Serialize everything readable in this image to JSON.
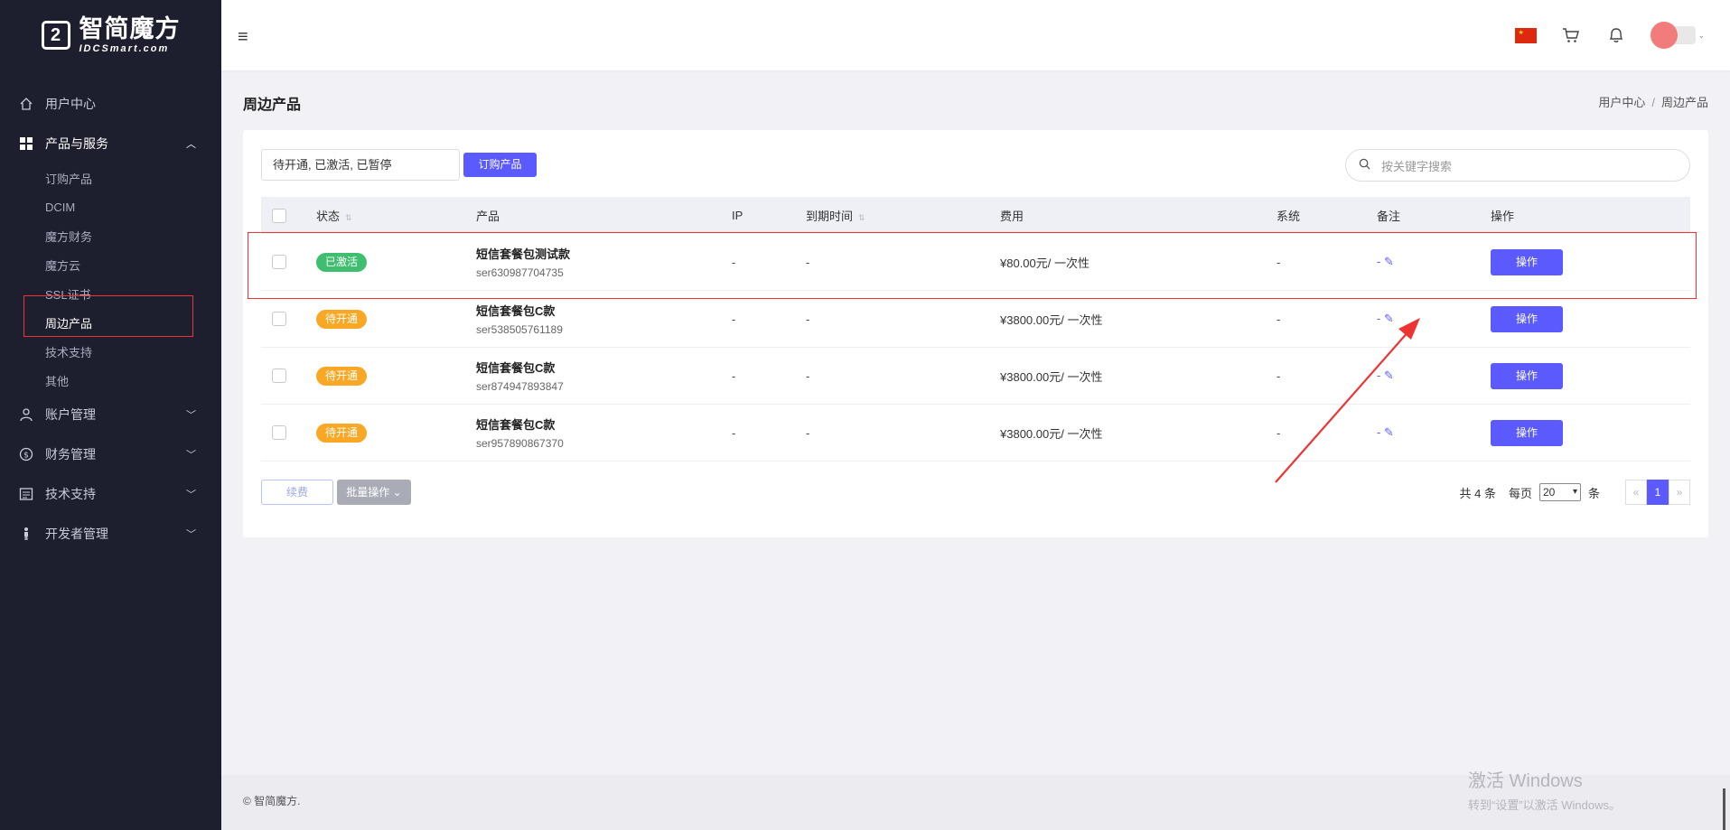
{
  "logo": {
    "cn": "智简魔方",
    "en": "IDCSmart.com"
  },
  "sidebar": {
    "items": [
      {
        "label": "用户中心",
        "icon": "home-icon"
      },
      {
        "label": "产品与服务",
        "icon": "grid-icon",
        "expanded": true,
        "children": [
          "订购产品",
          "DCIM",
          "魔方财务",
          "魔方云",
          "SSL证书",
          "周边产品",
          "技术支持",
          "其他"
        ],
        "current_child": "周边产品"
      },
      {
        "label": "账户管理",
        "icon": "user-icon"
      },
      {
        "label": "财务管理",
        "icon": "dollar-circle-icon"
      },
      {
        "label": "技术支持",
        "icon": "document-icon"
      },
      {
        "label": "开发者管理",
        "icon": "person-icon"
      }
    ]
  },
  "header": {
    "menu_icon": "hamburger-icon",
    "icons": [
      "china-flag-icon",
      "cart-icon",
      "bell-icon",
      "avatar"
    ]
  },
  "page": {
    "title": "周边产品",
    "breadcrumb": [
      "用户中心",
      "/",
      "周边产品"
    ]
  },
  "toolbar": {
    "filter_value": "待开通, 已激活, 已暂停",
    "order_button": "订购产品",
    "search_placeholder": "按关键字搜索"
  },
  "table": {
    "headers": {
      "status": "状态",
      "product": "产品",
      "ip": "IP",
      "expiry": "到期时间",
      "fee": "费用",
      "system": "系统",
      "note": "备注",
      "ops": "操作"
    },
    "rows": [
      {
        "status": "已激活",
        "status_color": "#3ebe6e",
        "name": "短信套餐包测试款",
        "id": "ser630987704735",
        "ip": "-",
        "expiry": "-",
        "fee": "¥80.00元/ 一次性",
        "system": "-",
        "note": "-",
        "op": "操作"
      },
      {
        "status": "待开通",
        "status_color": "#f8a824",
        "name": "短信套餐包C款",
        "id": "ser538505761189",
        "ip": "-",
        "expiry": "-",
        "fee": "¥3800.00元/ 一次性",
        "system": "-",
        "note": "-",
        "op": "操作"
      },
      {
        "status": "待开通",
        "status_color": "#f8a824",
        "name": "短信套餐包C款",
        "id": "ser874947893847",
        "ip": "-",
        "expiry": "-",
        "fee": "¥3800.00元/ 一次性",
        "system": "-",
        "note": "-",
        "op": "操作"
      },
      {
        "status": "待开通",
        "status_color": "#f8a824",
        "name": "短信套餐包C款",
        "id": "ser957890867370",
        "ip": "-",
        "expiry": "-",
        "fee": "¥3800.00元/ 一次性",
        "system": "-",
        "note": "-",
        "op": "操作"
      }
    ]
  },
  "bulk": {
    "renew": "续费",
    "batch": "批量操作"
  },
  "pagination": {
    "total_prefix": "共",
    "total": "4",
    "total_suffix": "条",
    "per_page_label": "每页",
    "per_page": "20",
    "per_page_suffix": "条",
    "prev": "«",
    "current": "1",
    "next": "»"
  },
  "footer": {
    "copyright": "© 智简魔方."
  },
  "watermark": {
    "line1": "激活 Windows",
    "line2": "转到“设置”以激活 Windows。"
  },
  "colors": {
    "primary": "#5a5aff",
    "sidebar_bg": "#1e1f2e",
    "active": "#3ebe6e",
    "pending": "#f8a824",
    "annotation_red": "#e33"
  }
}
